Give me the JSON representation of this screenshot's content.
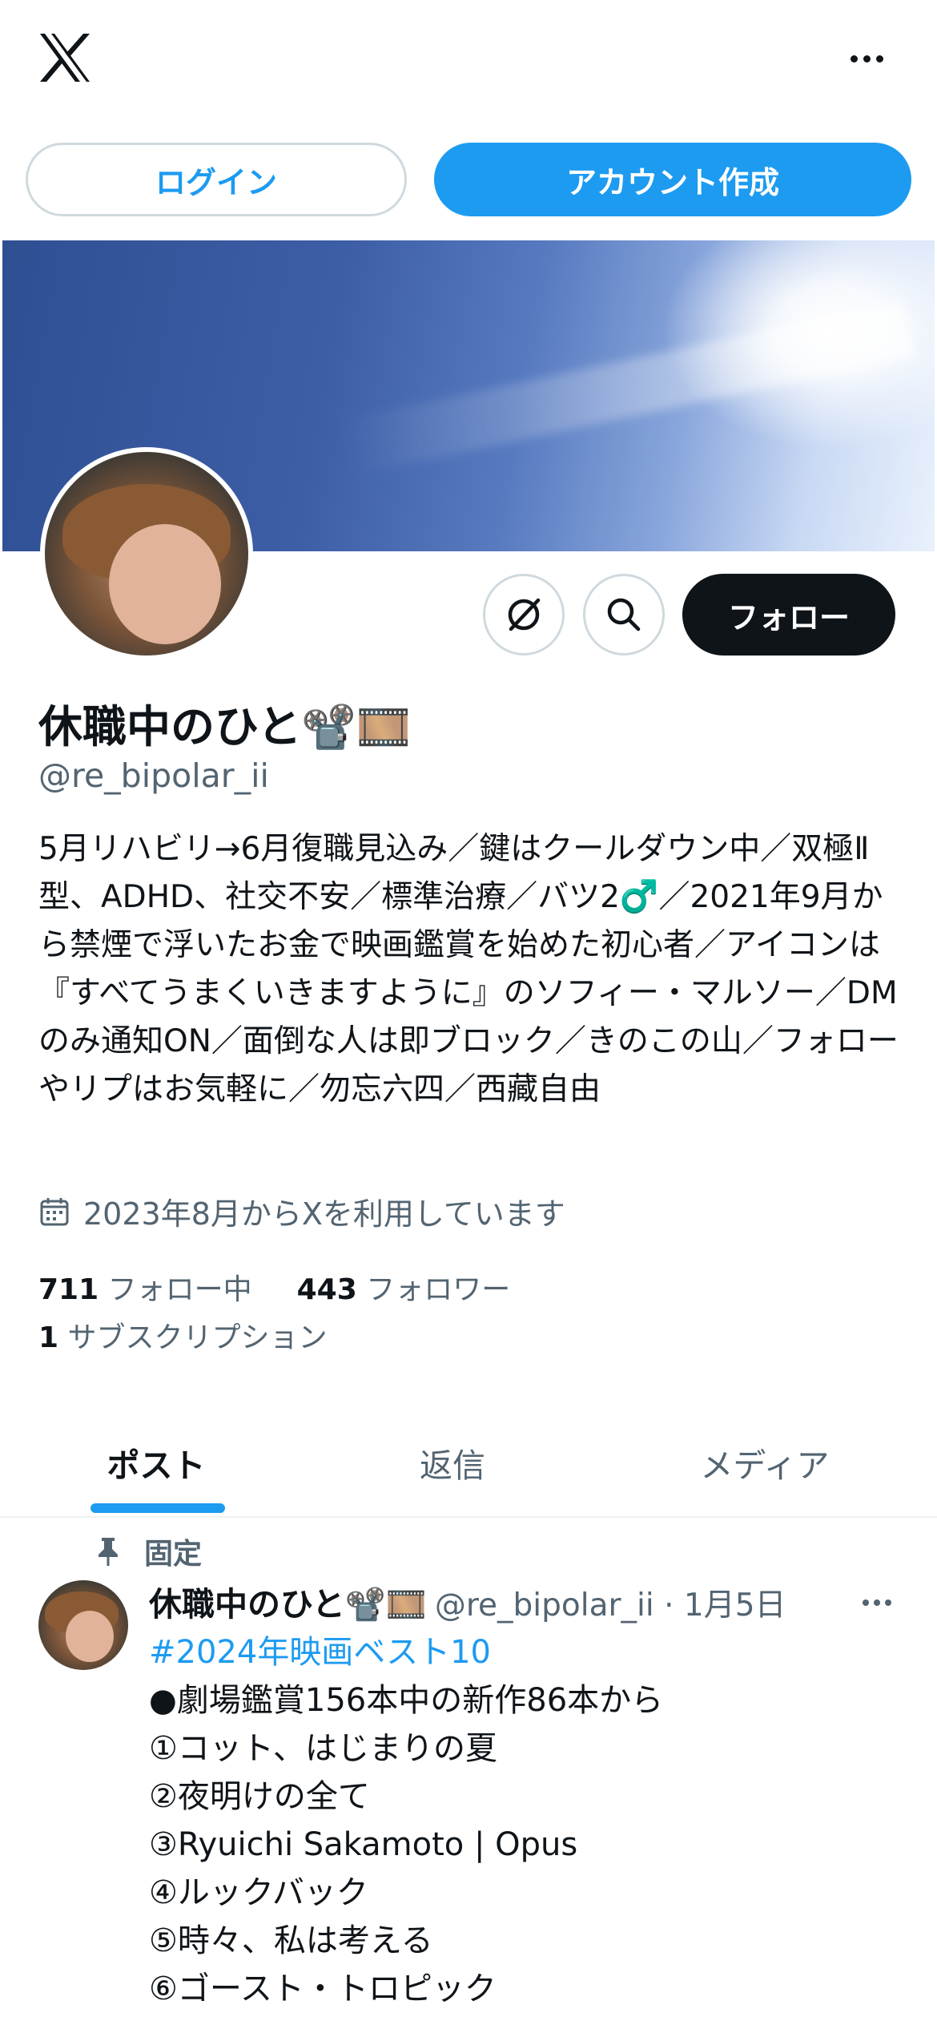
{
  "topbar": {
    "logo_icon": "x-logo-icon",
    "more_icon": "more-icon"
  },
  "auth": {
    "login_label": "ログイン",
    "signup_label": "アカウント作成"
  },
  "profile_actions": {
    "grok_icon": "grok-icon",
    "search_icon": "search-icon",
    "follow_label": "フォロー"
  },
  "profile": {
    "display_name": "休職中のひと📽️🎞️",
    "handle": "@re_bipolar_ii",
    "bio": "5月リハビリ→6月復職見込み／鍵はクールダウン中／双極Ⅱ型、ADHD、社交不安／標準治療／バツ2♂️／2021年9月から禁煙で浮いたお金で映画鑑賞を始めた初心者／アイコンは『すべてうまくいきますように』のソフィー・マルソー／DMのみ通知ON／面倒な人は即ブロック／きのこの山／フォローやリプはお気軽に／勿忘六四／西藏自由",
    "joined": "2023年8月からXを利用しています",
    "following_count": "711",
    "following_label": "フォロー中",
    "followers_count": "443",
    "followers_label": "フォロワー",
    "subscriptions_count": "1",
    "subscriptions_label": "サブスクリプション"
  },
  "tabs": [
    {
      "label": "ポスト",
      "active": true
    },
    {
      "label": "返信",
      "active": false
    },
    {
      "label": "メディア",
      "active": false
    }
  ],
  "pinned_post": {
    "pinned_label": "固定",
    "author_name": "休職中のひと📽️🎞️",
    "author_meta": "@re_bipolar_ii · 1月5日",
    "hashtag": "#2024年映画ベスト10",
    "lines": [
      "●劇場鑑賞156本中の新作86本から",
      "①コット、はじまりの夏",
      "②夜明けの全て",
      "③Ryuichi Sakamoto | Opus",
      "④ルックバック",
      "⑤時々、私は考える",
      "⑥ゴースト・トロピック"
    ]
  },
  "colors": {
    "accent": "#1d9bf0",
    "text": "#0f1419",
    "muted": "#536471",
    "border": "#cfd9de"
  }
}
